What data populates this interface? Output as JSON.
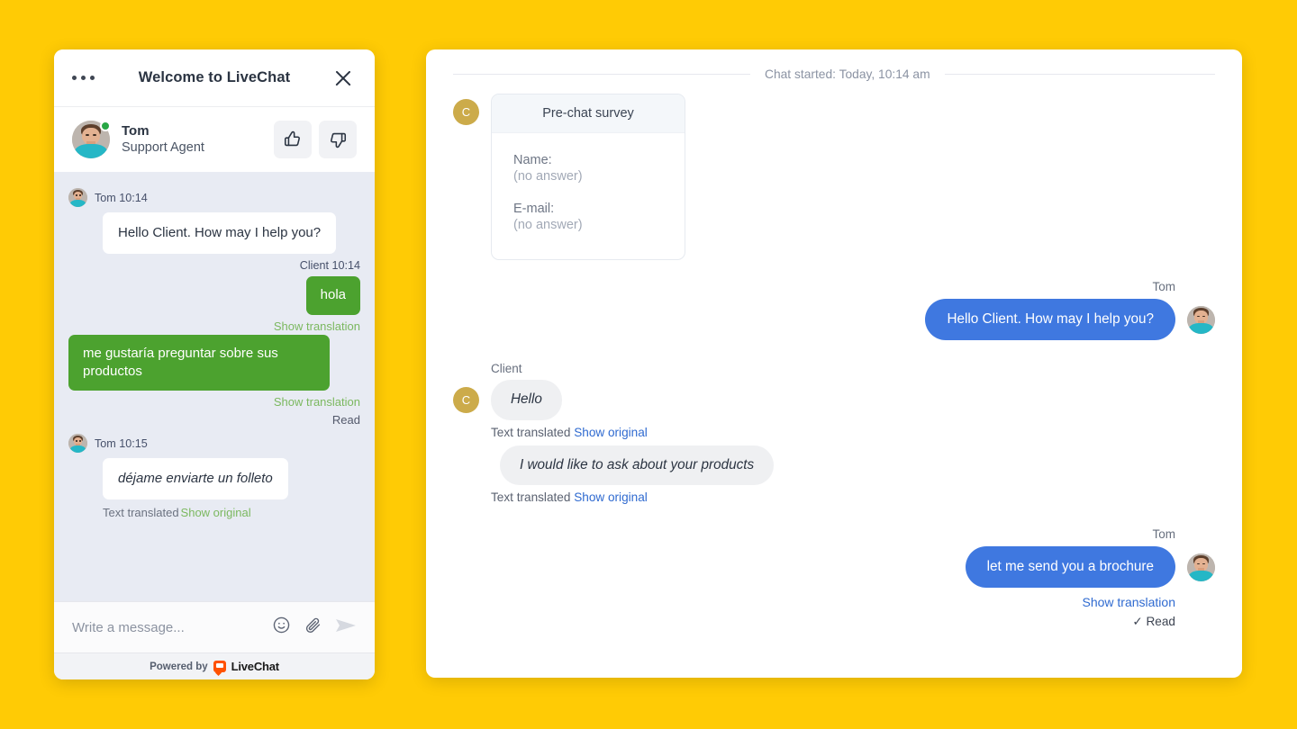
{
  "page": {
    "background_color": "#FFCB05"
  },
  "widget": {
    "title": "Welcome to LiveChat",
    "menu_icon": "ellipsis-icon",
    "close_icon": "close-icon",
    "agent": {
      "name": "Tom",
      "role": "Support Agent",
      "status": "online"
    },
    "rate": {
      "up_icon": "thumbs-up-icon",
      "down_icon": "thumbs-down-icon"
    },
    "messages": [
      {
        "id": "w-m1",
        "side": "left",
        "meta": "Tom 10:14",
        "text": "Hello Client. How may I help you?",
        "italic": false
      },
      {
        "id": "w-m2",
        "side": "right",
        "meta": "Client 10:14",
        "text": "hola",
        "sub": "Show translation"
      },
      {
        "id": "w-m3",
        "side": "right",
        "text": "me gustaría preguntar sobre sus productos",
        "sub": "Show translation",
        "status": "Read"
      },
      {
        "id": "w-m4",
        "side": "left",
        "meta": "Tom 10:15",
        "text": "déjame enviarte un folleto",
        "italic": true,
        "sub_prefix": "Text translated",
        "sub_link": "Show original"
      }
    ],
    "composer": {
      "placeholder": "Write a message...",
      "emoji_icon": "smiley-icon",
      "attach_icon": "paperclip-icon",
      "send_icon": "send-icon"
    },
    "footer": {
      "powered_by": "Powered by",
      "brand": "LiveChat",
      "brand_icon": "livechat-logo-icon"
    }
  },
  "agent_app": {
    "chat_started": "Chat started: Today, 10:14 am",
    "client_initial": "C",
    "survey": {
      "title": "Pre-chat survey",
      "fields": [
        {
          "label": "Name:",
          "value": "(no answer)"
        },
        {
          "label": "E-mail:",
          "value": "(no answer)"
        }
      ]
    },
    "messages": [
      {
        "id": "a-m1",
        "side": "right",
        "sender": "Tom",
        "text": "Hello Client. How may I help you?"
      },
      {
        "id": "a-m2",
        "side": "left",
        "sender": "Client",
        "text": "Hello",
        "trans_prefix": "Text translated",
        "trans_link": "Show original"
      },
      {
        "id": "a-m3",
        "side": "left",
        "text": "I would like to ask about your products",
        "trans_prefix": "Text translated",
        "trans_link": "Show original"
      },
      {
        "id": "a-m4",
        "side": "right",
        "sender": "Tom",
        "text": "let me send you a brochure",
        "show_translation": "Show translation",
        "read_status": "✓ Read"
      }
    ]
  },
  "colors": {
    "page_yellow": "#FFCB05",
    "client_green": "#4CA22F",
    "agent_blue": "#3F78E0",
    "link_green": "#7BB85F",
    "link_blue": "#2F6AD0",
    "client_avatar_gold": "#CCAB4A",
    "widget_msg_bg": "#E8EBF3"
  }
}
